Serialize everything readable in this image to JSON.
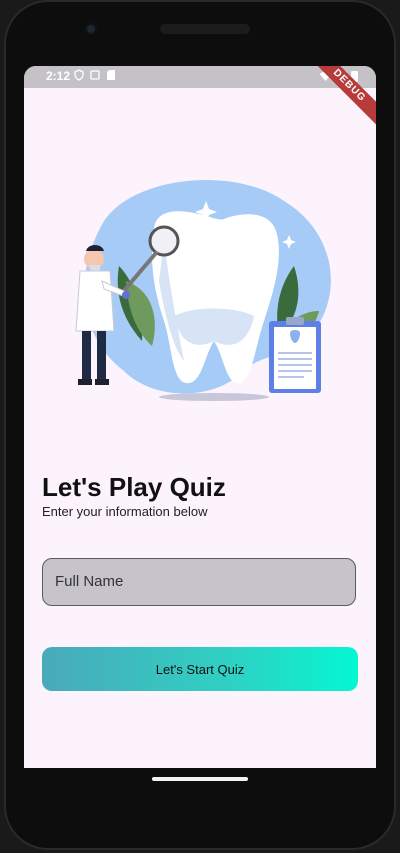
{
  "status_bar": {
    "time": "2:12",
    "debug_banner": "DEBUG"
  },
  "illustration": {
    "icon": "dentist-tooth-illustration"
  },
  "quiz": {
    "title": "Let's Play Quiz",
    "subtitle": "Enter your information below",
    "full_name_label": "Full Name",
    "start_button_label": "Let's Start Quiz"
  },
  "colors": {
    "screen_bg": "#fcf3fc",
    "field_bg": "#c6c3cb",
    "button_gradient_start": "#4aa9b9",
    "button_gradient_end": "#05f7d2",
    "blob_blue": "#a7cbf7"
  }
}
